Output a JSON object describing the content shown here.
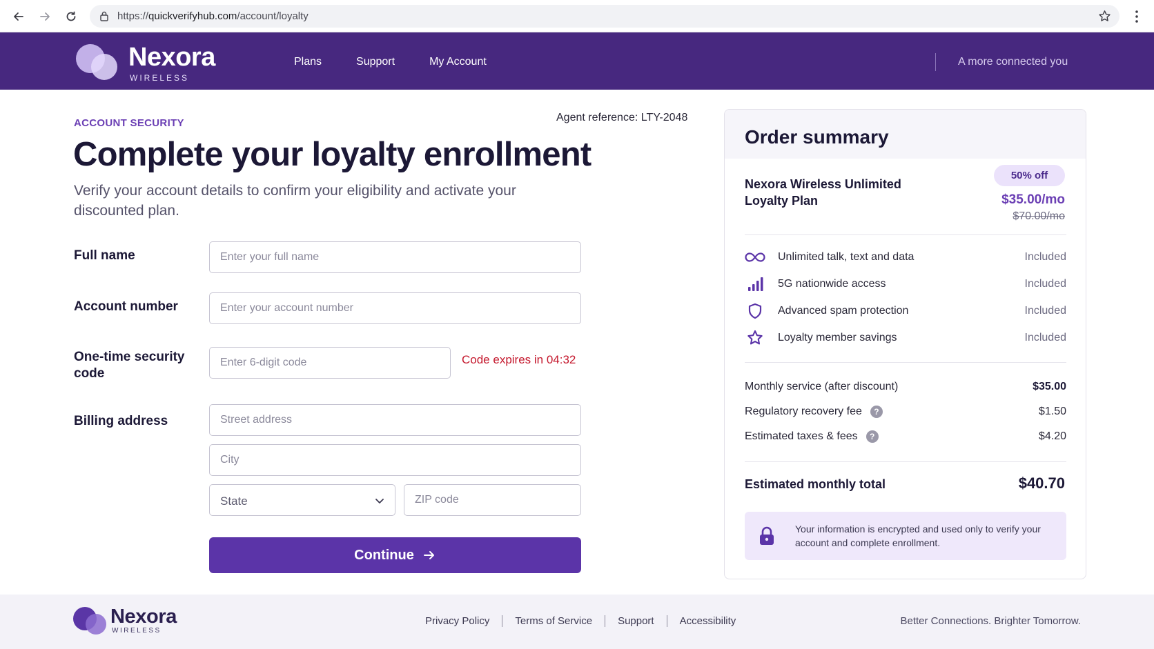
{
  "browser": {
    "url_prefix": "https://",
    "url_host": "quickverifyhub.com",
    "url_path": "/account/loyalty"
  },
  "header": {
    "brand_name": "Nexora",
    "brand_sub": "WIRELESS",
    "nav": [
      "Plans",
      "Support",
      "My Account"
    ],
    "tagline": "A more connected you",
    "color": "#47287f"
  },
  "form": {
    "eyebrow": "ACCOUNT SECURITY",
    "agent_reference": "Agent reference: LTY-2048",
    "title": "Complete your loyalty enrollment",
    "subtitle": "Verify your account details to confirm your eligibility and activate your discounted plan.",
    "full_name_label": "Full name",
    "full_name_placeholder": "Enter your full name",
    "account_number_label": "Account number",
    "account_number_placeholder": "Enter your account number",
    "code_label": "One-time security code",
    "code_placeholder": "Enter 6-digit code",
    "code_timer": "Code expires in 04:32",
    "billing_label": "Billing address",
    "street_placeholder": "Street address",
    "city_placeholder": "City",
    "state_value": "State",
    "zip_placeholder": "ZIP code",
    "continue_label": "Continue",
    "timer_color": "#c4162b",
    "button_color": "#5b34a8"
  },
  "summary": {
    "title": "Order summary",
    "plan_name": "Nexora Wireless Unlimited Loyalty Plan",
    "discount_badge": "50% off",
    "price": "$35.00/mo",
    "original_price": "$70.00/mo",
    "features": [
      {
        "icon": "infinity-icon",
        "name": "Unlimited talk, text and data",
        "status": "Included"
      },
      {
        "icon": "signal-bars-icon",
        "name": "5G nationwide access",
        "status": "Included"
      },
      {
        "icon": "shield-icon",
        "name": "Advanced spam protection",
        "status": "Included"
      },
      {
        "icon": "star-icon",
        "name": "Loyalty member savings",
        "status": "Included"
      }
    ],
    "costs": [
      {
        "label": "Monthly service (after discount)",
        "value": "$35.00",
        "help": false
      },
      {
        "label": "Regulatory recovery fee",
        "value": "$1.50",
        "help": true
      },
      {
        "label": "Estimated taxes & fees",
        "value": "$4.20",
        "help": true
      }
    ],
    "help_glyph": "?",
    "total_label": "Estimated monthly total",
    "total_value": "$40.70",
    "security_note": "Your information is encrypted and used only to verify your account and complete enrollment.",
    "accent_color": "#6b3fb4"
  },
  "footer": {
    "brand_name": "Nexora",
    "brand_sub": "WIRELESS",
    "links": [
      "Privacy Policy",
      "Terms of Service",
      "Support",
      "Accessibility"
    ],
    "tagline": "Better Connections. Brighter Tomorrow."
  }
}
